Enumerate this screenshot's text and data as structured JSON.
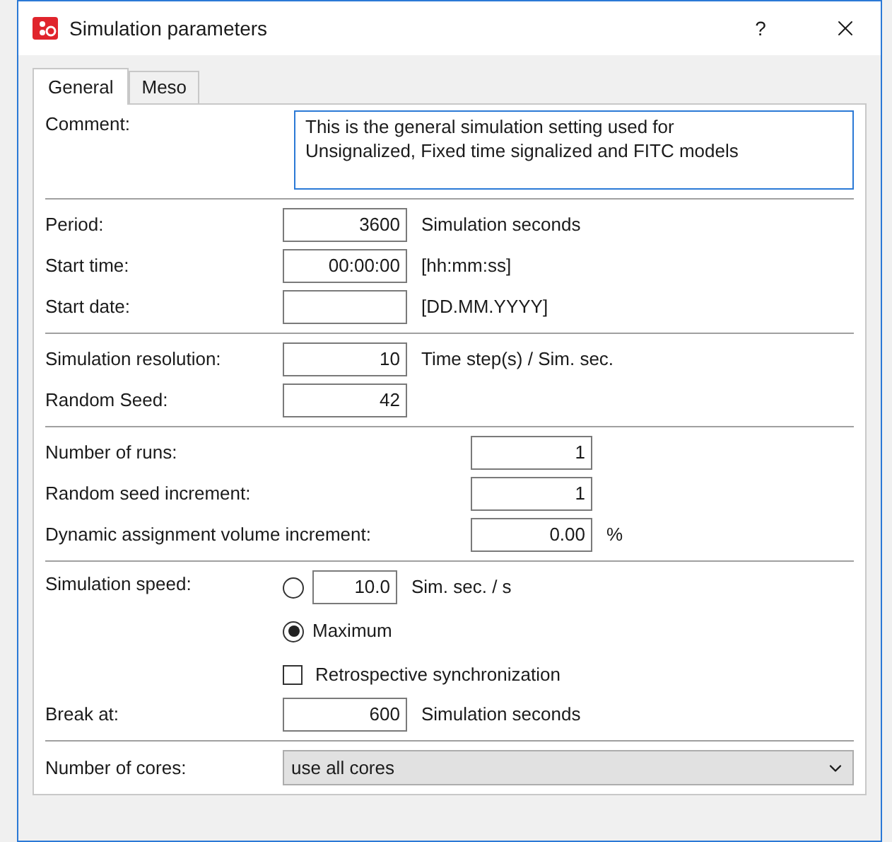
{
  "window": {
    "title": "Simulation parameters",
    "help": "?"
  },
  "tabs": [
    {
      "label": "General",
      "selected": true
    },
    {
      "label": "Meso",
      "selected": false
    }
  ],
  "comment": {
    "label": "Comment:",
    "value": "This is the general simulation setting used for\nUnsignalized, Fixed time signalized and FITC models"
  },
  "time_rows": [
    {
      "label": "Period:",
      "value": "3600",
      "unit": "Simulation seconds"
    },
    {
      "label": "Start time:",
      "value": "00:00:00",
      "unit": "[hh:mm:ss]"
    },
    {
      "label": "Start date:",
      "value": "",
      "unit": "[DD.MM.YYYY]"
    }
  ],
  "resolution_rows": [
    {
      "label": "Simulation resolution:",
      "value": "10",
      "unit": "Time step(s) / Sim. sec."
    },
    {
      "label": "Random Seed:",
      "value": "42"
    }
  ],
  "run_rows": [
    {
      "label": "Number of runs:",
      "value": "1"
    },
    {
      "label": "Random seed increment:",
      "value": "1"
    },
    {
      "label": "Dynamic assignment volume increment:",
      "value": "0.00",
      "unit": "%"
    }
  ],
  "speed": {
    "label": "Simulation speed:",
    "options": [
      {
        "kind": "value",
        "value": "10.0",
        "unit": "Sim. sec. / s",
        "selected": false
      },
      {
        "kind": "text",
        "label": "Maximum",
        "selected": true
      }
    ],
    "retro": {
      "label": "Retrospective synchronization",
      "checked": false
    }
  },
  "break_at": {
    "label": "Break at:",
    "value": "600",
    "unit": "Simulation seconds"
  },
  "cores": {
    "label": "Number of cores:",
    "value": "use all cores"
  }
}
